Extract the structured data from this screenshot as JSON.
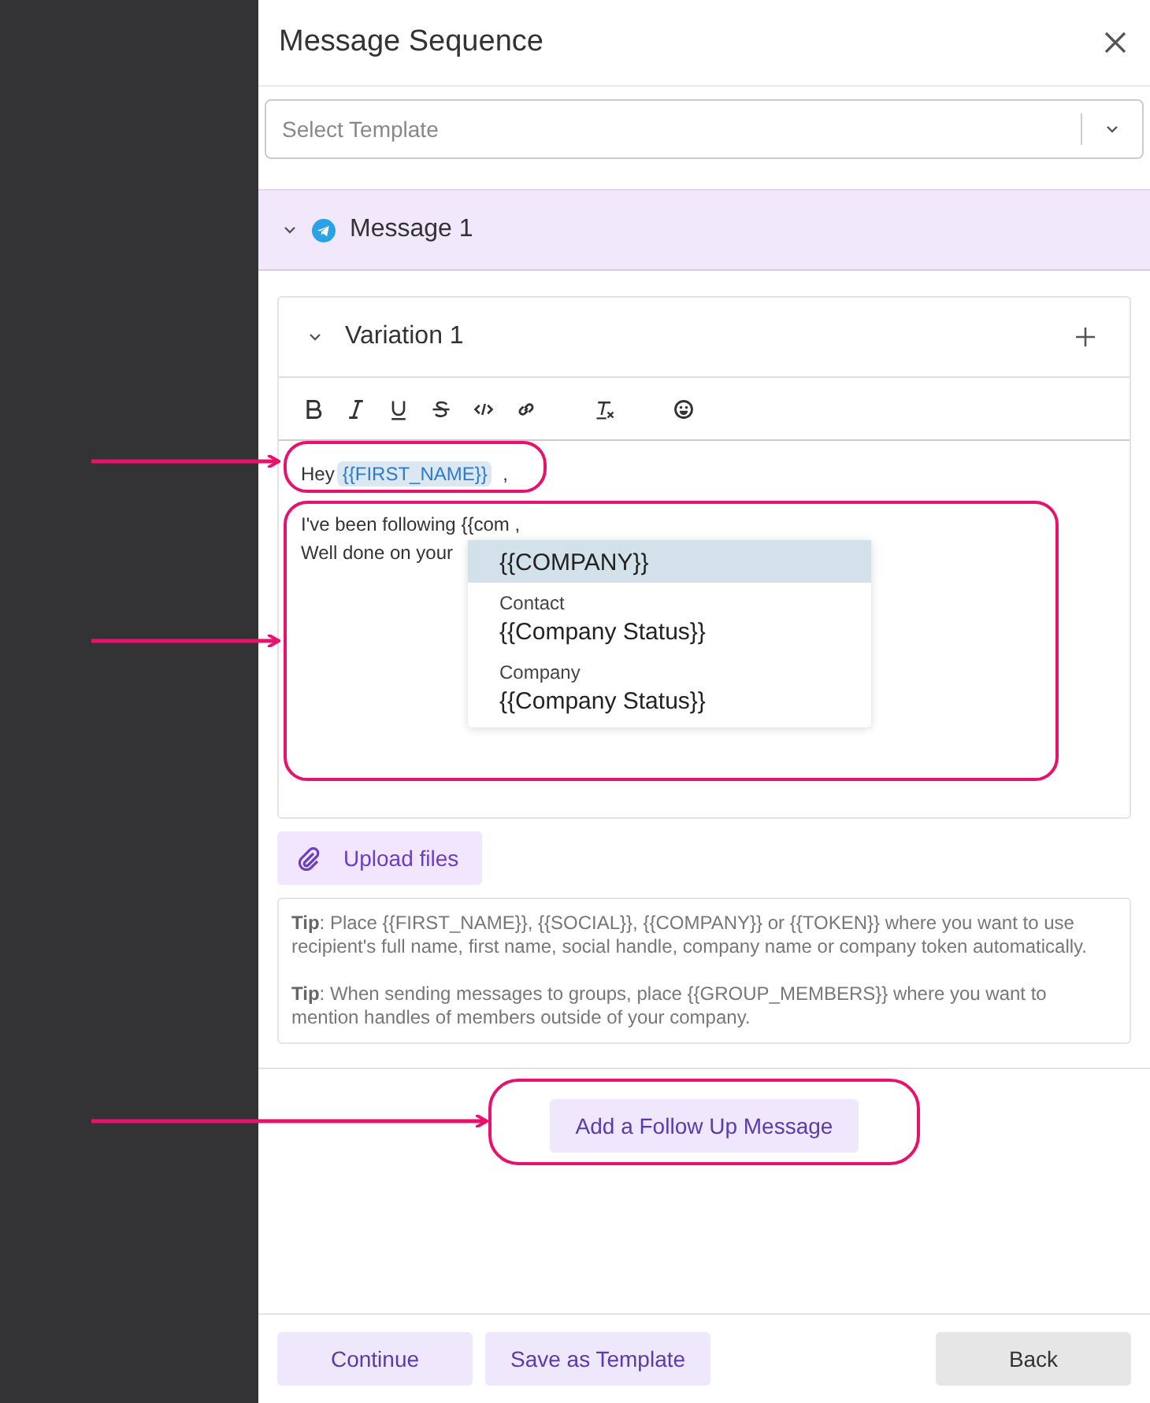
{
  "panel": {
    "title": "Message Sequence"
  },
  "template_select": {
    "placeholder": "Select Template"
  },
  "message": {
    "title": "Message 1",
    "expanded": true
  },
  "variation": {
    "title": "Variation 1",
    "expanded": true
  },
  "editor": {
    "lines": [
      "Hey ",
      "{{FIRST_NAME}}",
      " ,"
    ],
    "body": [
      "I've been following {{com ,",
      "Well done on your"
    ]
  },
  "suggestions": [
    {
      "label": "{{COMPANY}}",
      "selected": true
    },
    {
      "group": "Contact",
      "label": "{{Company Status}}",
      "selected": false
    },
    {
      "group": "Company",
      "label": "{{Company Status}}",
      "selected": false
    }
  ],
  "upload_button": "Upload files",
  "tips": [
    "**Tip**: Place {{FIRST_NAME}}, {{SOCIAL}}, {{COMPANY}} or {{TOKEN}} where you want to use recipient's full name, first name, social handle, company name or company token automatically.",
    "**Tip**: When sending messages to groups, place {{GROUP_MEMBERS}} where you want to mention handles of members outside of your company."
  ],
  "add_follow_up": "Add a Follow Up Message",
  "footer_buttons": [
    {
      "label": "Continue",
      "kind": "accent"
    },
    {
      "label": "Save as Template",
      "kind": "accent"
    },
    {
      "label": "Back",
      "kind": "neutral"
    }
  ]
}
